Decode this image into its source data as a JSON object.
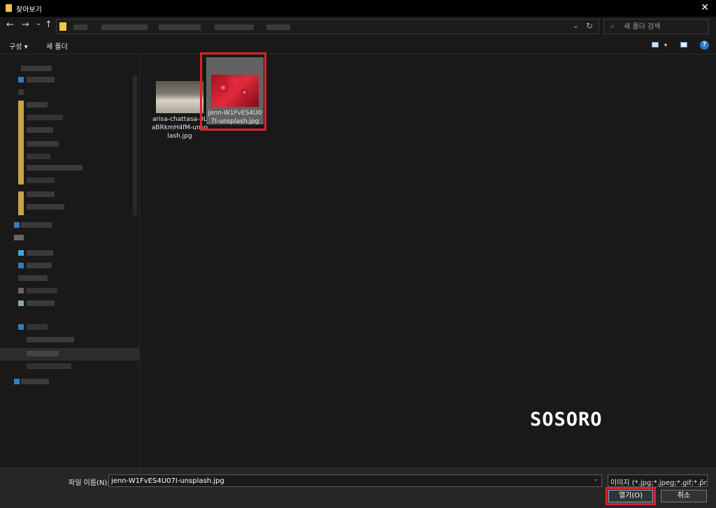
{
  "window": {
    "title": "찾아보기",
    "close_glyph": "✕"
  },
  "nav": {
    "back": "←",
    "forward": "→",
    "recent": "⌄",
    "up": "↑",
    "dropdown": "⌄",
    "refresh": "↻"
  },
  "search": {
    "placeholder": "새 폴더 검색",
    "icon": "search-icon"
  },
  "toolbar": {
    "organize_label": "구성 ▾",
    "new_folder_label": "새 폴더",
    "help_label": "?"
  },
  "files": [
    {
      "name": "arisa-chattasa-0LaBRkmH4fM-unsplash.jpg",
      "selected": false
    },
    {
      "name": "jenn-W1FvES4U07I-unsplash.jpg",
      "selected": true
    }
  ],
  "watermark": "SOSORO",
  "bottom": {
    "file_name_label": "파일 이름(N):",
    "file_name_value": "jenn-W1FvES4U07I-unsplash.jpg",
    "file_type_value": "이미지 (*.jpg;*.jpeg;*.gif;*.png;",
    "open_button": "열기(O)",
    "cancel_button": "취소"
  },
  "colors": {
    "highlight": "#e0202e",
    "folder": "#f3c64a",
    "background": "#191919"
  }
}
